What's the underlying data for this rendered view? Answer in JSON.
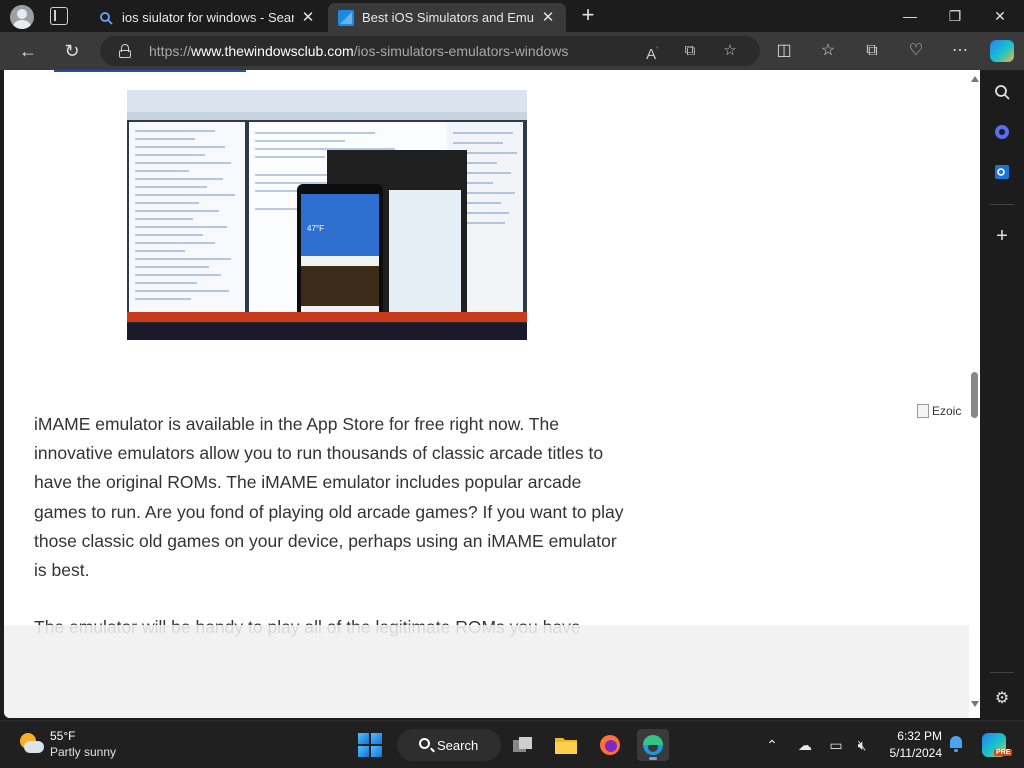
{
  "browser": {
    "tabs": [
      {
        "label": "ios siulator for windows - Search",
        "favicon": "search-favicon",
        "active": false
      },
      {
        "label": "Best iOS Simulators and Emulators",
        "favicon": "twc-favicon",
        "active": true
      }
    ],
    "address": {
      "scheme": "https://",
      "domain": "www.thewindowsclub.com",
      "path": "/ios-simulators-emulators-windows"
    }
  },
  "article": {
    "image_caption": "Visual Studio with iOS simulator screenshot",
    "paragraph1": "iMAME emulator is available in the App Store for free right now.  The innovative emulators allow you to run thousands of classic arcade titles to have the original ROMs. The iMAME emulator includes popular arcade games to run. Are you fond of playing old arcade games? If you want to play those classic old games on your device, perhaps using an iMAME emulator is best.",
    "paragraph2": "The emulator will be handy to play all of the legitimate ROMs you have",
    "ad_alt": "Ezoic"
  },
  "taskbar": {
    "temperature": "55°F",
    "condition": "Partly sunny",
    "search_label": "Search",
    "time": "6:32 PM",
    "date": "5/11/2024",
    "copilot_badge": "PRE"
  },
  "colors": {
    "accent": "#2a7ef5",
    "page_bg": "#ffffff",
    "chrome_bg": "#1c1c1c"
  }
}
